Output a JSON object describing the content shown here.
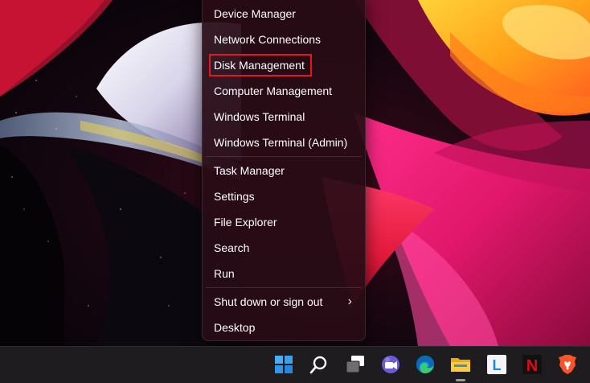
{
  "context_menu": {
    "items": [
      {
        "label": "Device Manager"
      },
      {
        "label": "Network Connections"
      },
      {
        "label": "Disk Management",
        "highlighted": true
      },
      {
        "label": "Computer Management"
      },
      {
        "label": "Windows Terminal"
      },
      {
        "label": "Windows Terminal (Admin)"
      },
      {
        "label": "Task Manager"
      },
      {
        "label": "Settings"
      },
      {
        "label": "File Explorer"
      },
      {
        "label": "Search"
      },
      {
        "label": "Run"
      },
      {
        "label": "Shut down or sign out",
        "submenu": true
      },
      {
        "label": "Desktop"
      }
    ],
    "highlight_color": "#e8161e"
  },
  "taskbar": {
    "icons": [
      {
        "name": "windows-start-icon"
      },
      {
        "name": "search-icon"
      },
      {
        "name": "task-view-icon"
      },
      {
        "name": "teams-chat-icon"
      },
      {
        "name": "edge-icon"
      },
      {
        "name": "file-explorer-icon",
        "running": true
      },
      {
        "name": "app-l-icon",
        "letter": "L"
      },
      {
        "name": "netflix-icon",
        "letter": "N"
      },
      {
        "name": "brave-icon"
      }
    ],
    "accent_colors": {
      "start": "#3aa0f0",
      "netflix": "#e50914",
      "brave": "#fb542b",
      "app_l": "#1e8ad6"
    }
  }
}
